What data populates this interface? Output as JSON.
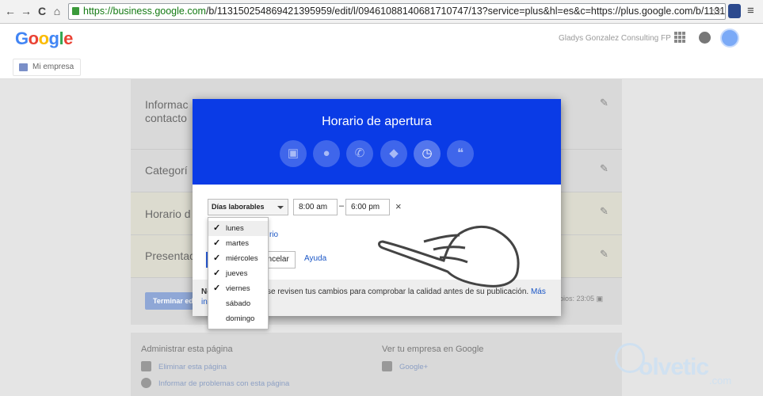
{
  "browser": {
    "url_host": "https://business.google.com",
    "url_path": "/b/113150254869421395959/edit/l/09461088140681710747/13?service=plus&hl=es&c=https://plus.google.com/b/113150254869421395959",
    "back": "←",
    "forward": "→",
    "reload": "C",
    "home": "⌂",
    "star": "☆",
    "menu": "≡"
  },
  "header": {
    "logo": [
      "G",
      "o",
      "o",
      "g",
      "l",
      "e"
    ],
    "account_name": "Gladys Gonzalez Consulting FP",
    "breadcrumb": "Mi empresa",
    "icons": [
      "apps-grid-icon",
      "notifications-icon",
      "avatar"
    ]
  },
  "background_sections": [
    {
      "label_line1": "Informac",
      "label_line2": "contacto"
    },
    {
      "label_line1": "Categorí"
    },
    {
      "label_line1": "Horario d"
    },
    {
      "label_line1": "Presentac"
    }
  ],
  "bg_footer": {
    "save_button": "Terminar edi",
    "saved_text": "bios: 23:05"
  },
  "footer": {
    "manage_heading": "Administrar esta página",
    "delete_link": "Eliminar esta página",
    "report_link": "Informar de problemas con esta página",
    "view_heading": "Ver tu empresa en Google",
    "gplus_link": "Google+"
  },
  "modal": {
    "title": "Horario de apertura",
    "tabs": [
      {
        "icon": "contact-card-icon",
        "glyph": "▣"
      },
      {
        "icon": "location-pin-icon",
        "glyph": "●"
      },
      {
        "icon": "phone-icon",
        "glyph": "✆"
      },
      {
        "icon": "tag-icon",
        "glyph": "◆"
      },
      {
        "icon": "clock-icon",
        "glyph": "◷",
        "active": true
      },
      {
        "icon": "quote-icon",
        "glyph": "❝"
      }
    ],
    "days_select": "Días laborables",
    "open_time": "8:00 am",
    "dash": "–",
    "close_time": "6:00 pm",
    "remove": "×",
    "add_hours_partial": "rio",
    "cancel_partial": "ancelar",
    "help": "Ayuda",
    "notice_bold": "No",
    "notice_text": "se revisen tus cambios para comprobar la calidad antes de su publicación.",
    "notice_more": "Más",
    "notice_partial": "in"
  },
  "dropdown": {
    "items": [
      {
        "label": "lunes",
        "checked": true,
        "highlighted": true
      },
      {
        "label": "martes",
        "checked": true
      },
      {
        "label": "miércoles",
        "checked": true
      },
      {
        "label": "jueves",
        "checked": true
      },
      {
        "label": "viernes",
        "checked": true
      },
      {
        "label": "sábado",
        "checked": false
      },
      {
        "label": "domingo",
        "checked": false
      }
    ]
  },
  "watermark": {
    "text": "olvetic",
    "suffix": ".com"
  }
}
